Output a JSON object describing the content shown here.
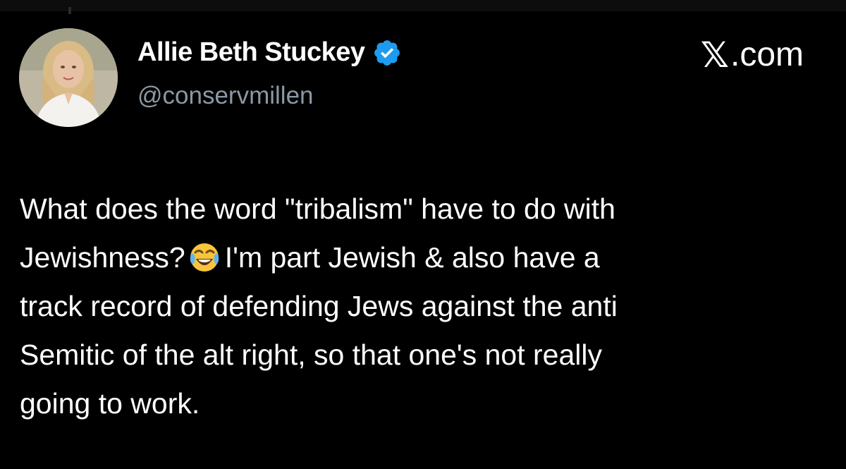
{
  "author": {
    "display_name": "Allie Beth Stuckey",
    "handle": "@conservmillen",
    "verified": true,
    "verified_icon": "verified-badge-icon",
    "avatar_icon": "profile-photo"
  },
  "site": {
    "label": ".com",
    "logo_icon": "x-logo-icon",
    "logo_glyph": "𝕏"
  },
  "tweet": {
    "lines": [
      "What does the word \"tribalism\" have to do with",
      "Jewishness?",
      "I'm part Jewish & also  have a",
      "track record of defending Jews against the anti",
      "Semitic of the alt right, so that one's not really",
      "going to work."
    ],
    "emoji": "face-with-tears-of-joy-icon"
  },
  "colors": {
    "background": "#000000",
    "text": "#ffffff",
    "handle": "#8b98a5",
    "verified": "#1d9bf0"
  }
}
